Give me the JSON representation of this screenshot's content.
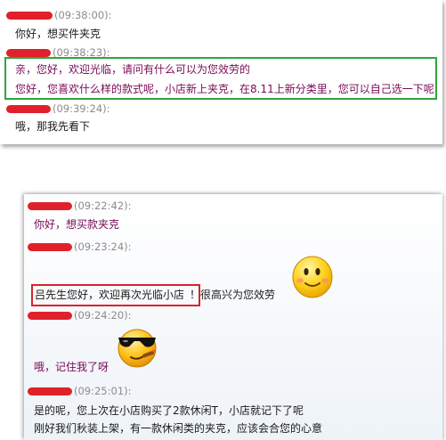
{
  "top_chat": {
    "entries": [
      {
        "time": "(09:38:00):",
        "lines": [
          "你好，想买件夹克"
        ]
      },
      {
        "time": "(09:38:23):",
        "lines": [
          "亲，您好，欢迎光临，请问有什么可以为您效劳的",
          "您好，您喜欢什么样的款式呢，小店新上夹克，在8.11上新分类里，您可以自己选一下呢"
        ]
      },
      {
        "time": "(09:39:24):",
        "lines": [
          "哦，那我先看下"
        ]
      }
    ]
  },
  "bottom_chat": {
    "entries": [
      {
        "time": "(09:22:42):",
        "lines": [
          "你好，想买款夹克"
        ]
      },
      {
        "time": "(09:23:24):",
        "boxed_text": "吕先生您好，欢迎再次光临小店",
        "after_text": "！很高兴为您效劳"
      },
      {
        "time": "(09:24:20):",
        "lines": [
          "哦，记住我了呀"
        ]
      },
      {
        "time": "(09:25:01):",
        "lines": [
          "是的呢，您上次在小店购买了2款休闲T，小店就记下了呢",
          "刚好我们秋装上架，有一款休闲类的夹克，应该会合您的心意"
        ]
      }
    ]
  },
  "emoticons": [
    "smile-emoji-icon",
    "cool-sunglasses-emoji-icon"
  ],
  "colors": {
    "highlight_green": "#2fa53d",
    "highlight_red": "#d8242d",
    "redaction": "#e0212b",
    "customer_text": "#7a0a57",
    "timestamp": "#8b8b8b"
  }
}
